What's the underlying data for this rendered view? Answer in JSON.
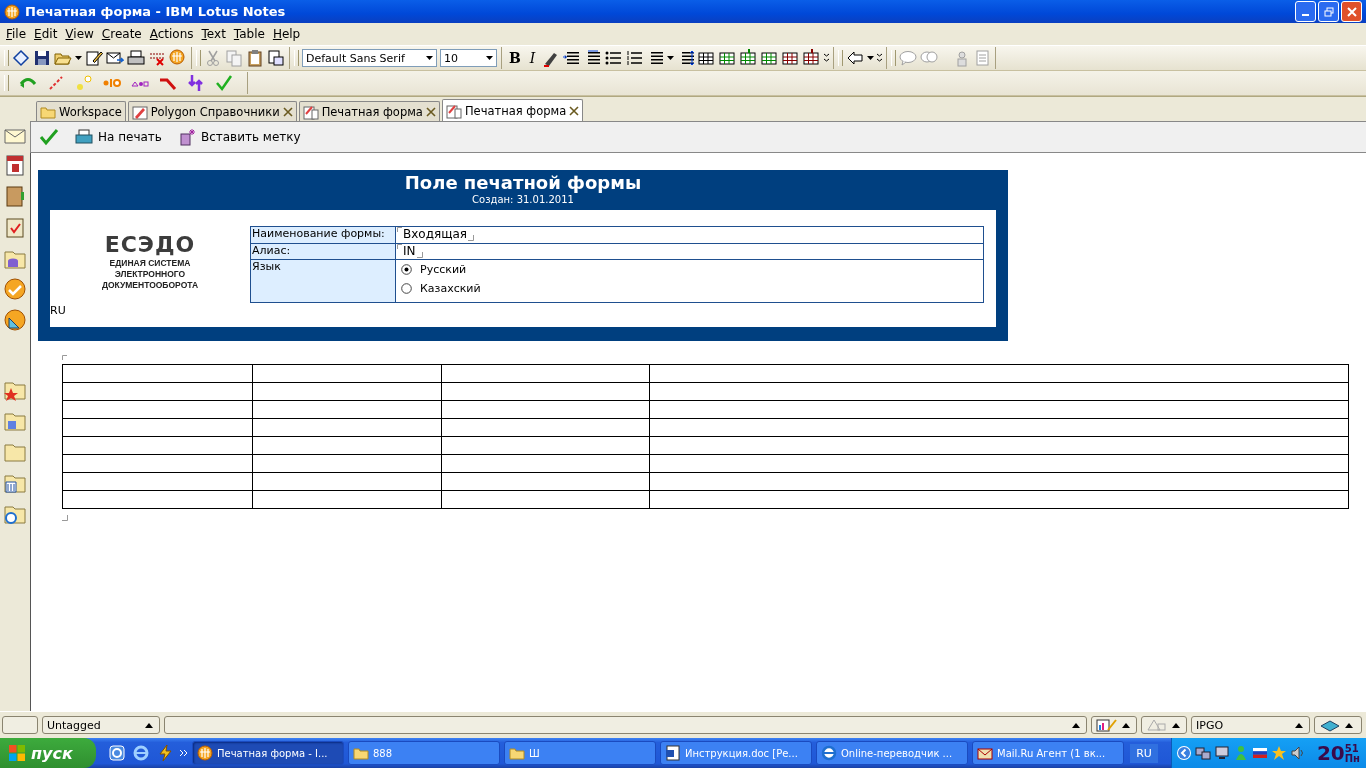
{
  "window": {
    "title": "Печатная форма - IBM Lotus Notes"
  },
  "menu": [
    "File",
    "Edit",
    "View",
    "Create",
    "Actions",
    "Text",
    "Table",
    "Help"
  ],
  "toolbar": {
    "font": "Default Sans Serif",
    "size": "10",
    "format_buttons": [
      "B",
      "I"
    ]
  },
  "tabs": [
    {
      "label": "Workspace",
      "selected": false,
      "closable": false,
      "kind": "workspace"
    },
    {
      "label": "Polygon Справочники",
      "selected": false,
      "closable": true,
      "kind": "database"
    },
    {
      "label": "Печатная форма",
      "selected": false,
      "closable": true,
      "kind": "form"
    },
    {
      "label": "Печатная форма",
      "selected": true,
      "closable": true,
      "kind": "form"
    }
  ],
  "actions": [
    {
      "kind": "check"
    },
    {
      "kind": "print",
      "label": "На печать"
    },
    {
      "kind": "tag",
      "label": "Вставить метку"
    }
  ],
  "form": {
    "title": "Поле печатной формы",
    "created": "Создан: 31.01.2011",
    "logo": {
      "name": "ЕСЭДО",
      "lines": [
        "ЕДИНАЯ СИСТЕМА",
        "ЭЛЕКТРОННОГО",
        "ДОКУМЕНТООБОРОТА"
      ]
    },
    "locale": "RU",
    "fields": [
      {
        "kind": "text",
        "label": "Наименование формы:",
        "value": "Входящая"
      },
      {
        "kind": "text",
        "label": "Алиас:",
        "value": "IN"
      },
      {
        "kind": "radio",
        "label": "Язык",
        "options": [
          {
            "label": "Русский",
            "selected": true
          },
          {
            "label": "Казахский",
            "selected": false
          }
        ]
      }
    ]
  },
  "status_bar": {
    "tag_menu": "Untagged",
    "location": "IPGO"
  },
  "taskbar": {
    "start": "пуск",
    "items": [
      {
        "kind": "notes",
        "label": "Печатная форма - I...",
        "selected": true
      },
      {
        "kind": "folder",
        "label": "888",
        "selected": false
      },
      {
        "kind": "folder",
        "label": "Ш",
        "selected": false
      },
      {
        "kind": "doc",
        "label": "Инструкция.doc [Ре...",
        "selected": false
      },
      {
        "kind": "browser",
        "label": "Online-переводчик ...",
        "selected": false
      },
      {
        "kind": "mail",
        "label": "Mail.Ru Агент (1 вк...",
        "selected": false
      }
    ],
    "language": "RU",
    "clock": {
      "hours": "20",
      "minutes": "51",
      "day": "Пн"
    }
  }
}
